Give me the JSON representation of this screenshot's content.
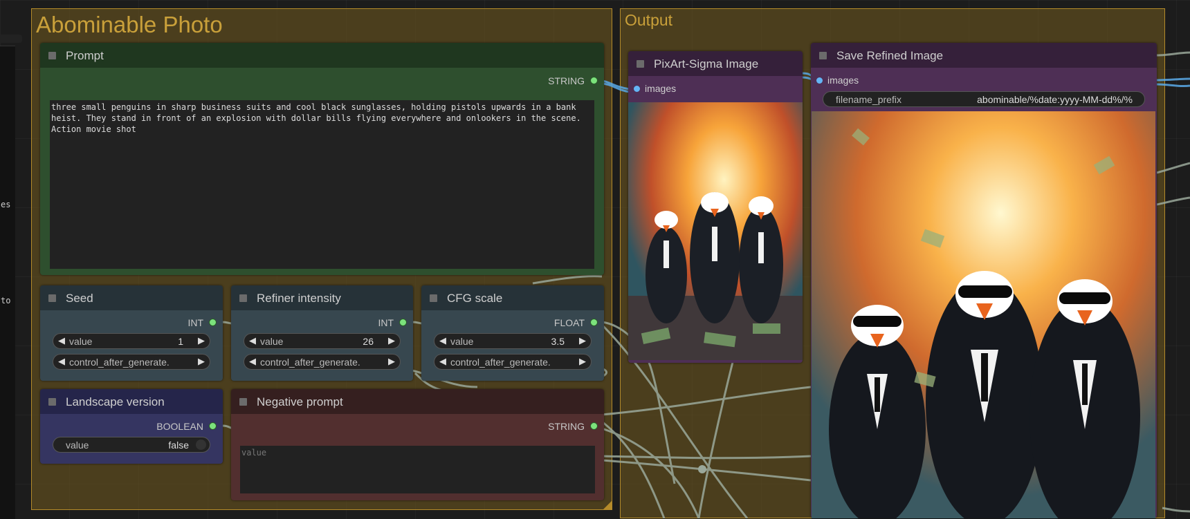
{
  "left_panel": {
    "cut_labels": [
      "es",
      "to"
    ]
  },
  "groups": {
    "abominable": {
      "title": "Abominable Photo"
    },
    "output": {
      "title": "Output"
    }
  },
  "nodes": {
    "prompt": {
      "title": "Prompt",
      "output_label": "STRING",
      "text": "three small penguins in sharp business suits and cool black sunglasses, holding pistols upwards in a bank heist. They stand in front of an explosion with dollar bills flying everywhere and onlookers in the scene. Action movie shot"
    },
    "seed": {
      "title": "Seed",
      "output_label": "INT",
      "value_name": "value",
      "value": "1",
      "control_name": "control_after_generate."
    },
    "refiner": {
      "title": "Refiner intensity",
      "output_label": "INT",
      "value_name": "value",
      "value": "26",
      "control_name": "control_after_generate."
    },
    "cfg": {
      "title": "CFG scale",
      "output_label": "FLOAT",
      "value_name": "value",
      "value": "3.5",
      "control_name": "control_after_generate."
    },
    "landscape": {
      "title": "Landscape version",
      "output_label": "BOOLEAN",
      "value_name": "value",
      "value": "false"
    },
    "negative": {
      "title": "Negative prompt",
      "output_label": "STRING",
      "placeholder": "value"
    },
    "pixart": {
      "title": "PixArt-Sigma Image",
      "input_label": "images"
    },
    "save": {
      "title": "Save Refined Image",
      "input_label": "images",
      "filename_name": "filename_prefix",
      "filename_value": "abominable/%date:yyyy-MM-dd%/%"
    }
  },
  "icons": {
    "arrow_left": "◀",
    "arrow_right": "▶"
  },
  "colors": {
    "group_border": "#b58b2a",
    "group_title": "#c9a03a",
    "prompt_node": "#2e4f2e",
    "value_node": "#37474f",
    "landscape_node": "#353561",
    "negative_node": "#522f2f",
    "image_node": "#4e2f55",
    "link": "#9aa89a",
    "link_blue": "#5aaae8",
    "socket_out": "#7ce27c",
    "socket_in": "#64b5f6"
  }
}
